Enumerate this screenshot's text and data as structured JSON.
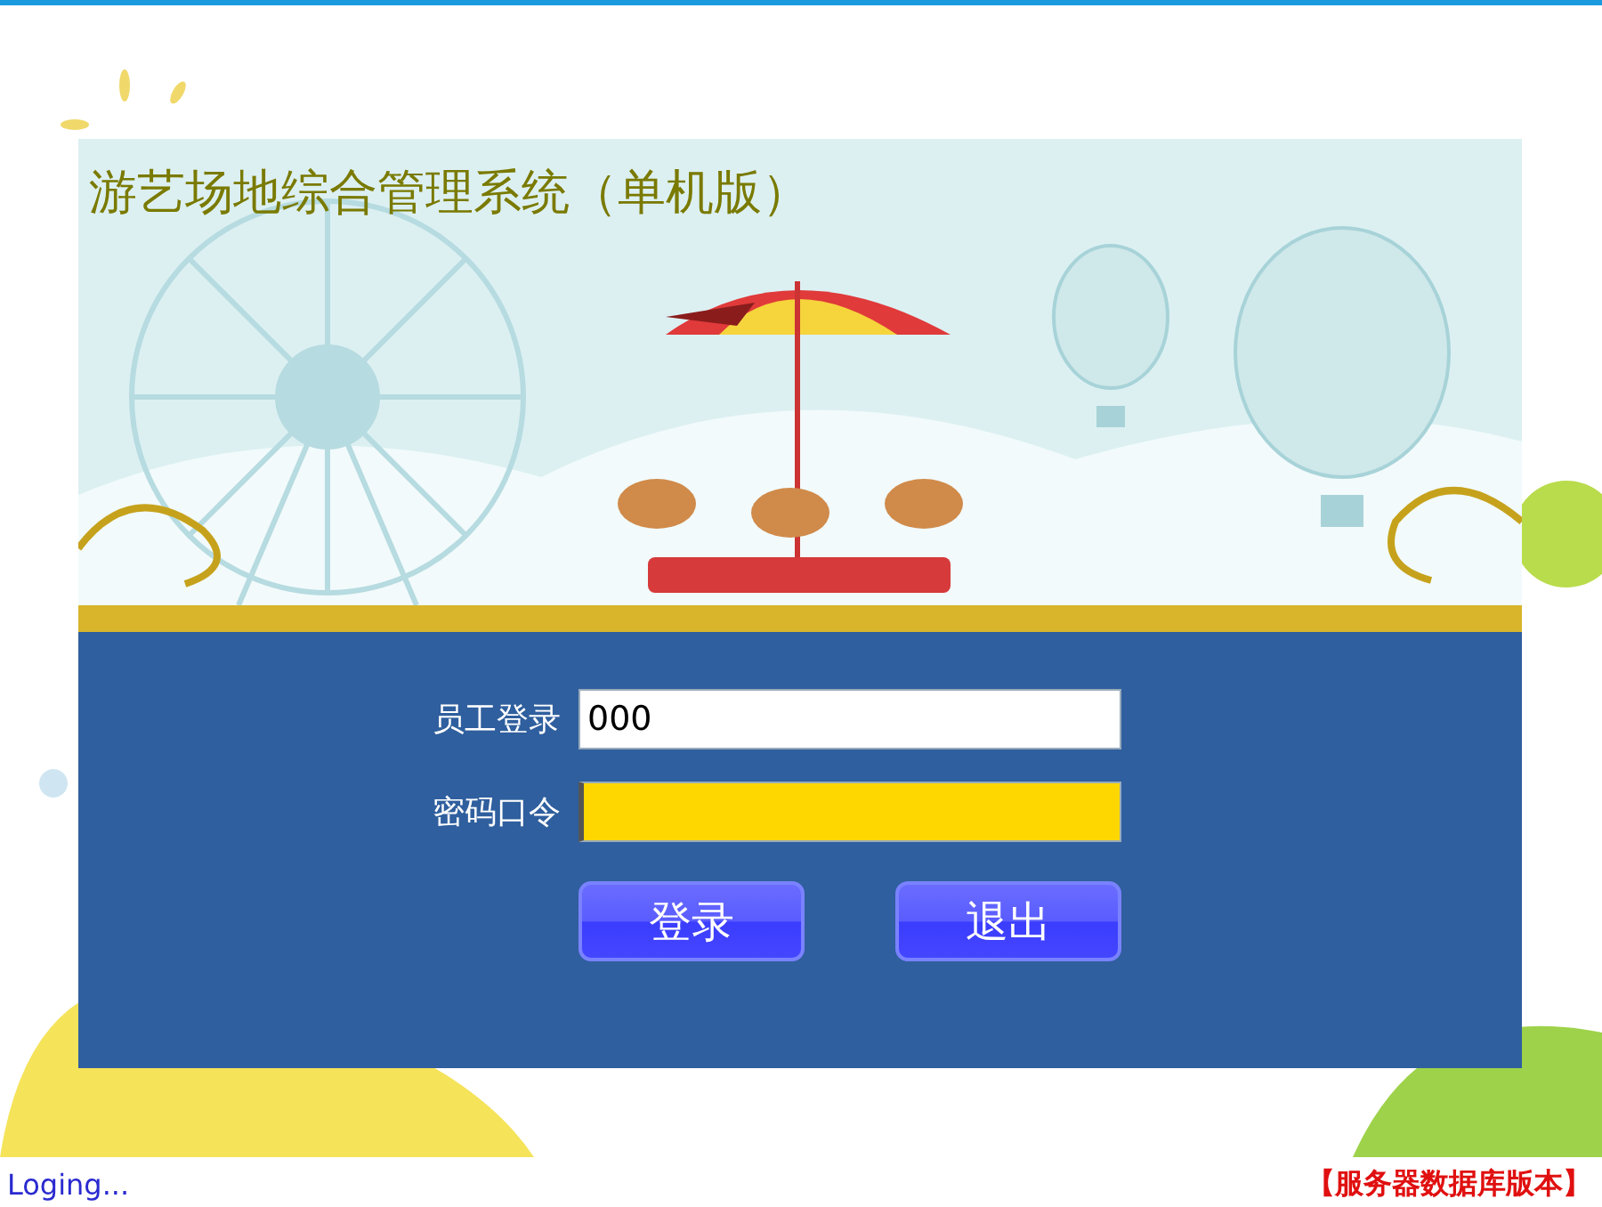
{
  "window": {
    "title": "游艺场地综合管理系统（单机版）"
  },
  "login_form": {
    "fields": [
      {
        "label": "员工登录",
        "kind": "text",
        "value": "000",
        "focused": false
      },
      {
        "label": "密码口令",
        "kind": "password",
        "focused": true
      }
    ],
    "buttons": [
      "登录",
      "退出"
    ]
  },
  "status_bar": {
    "message": "Loging...",
    "edition": "【服务器数据库版本】"
  }
}
